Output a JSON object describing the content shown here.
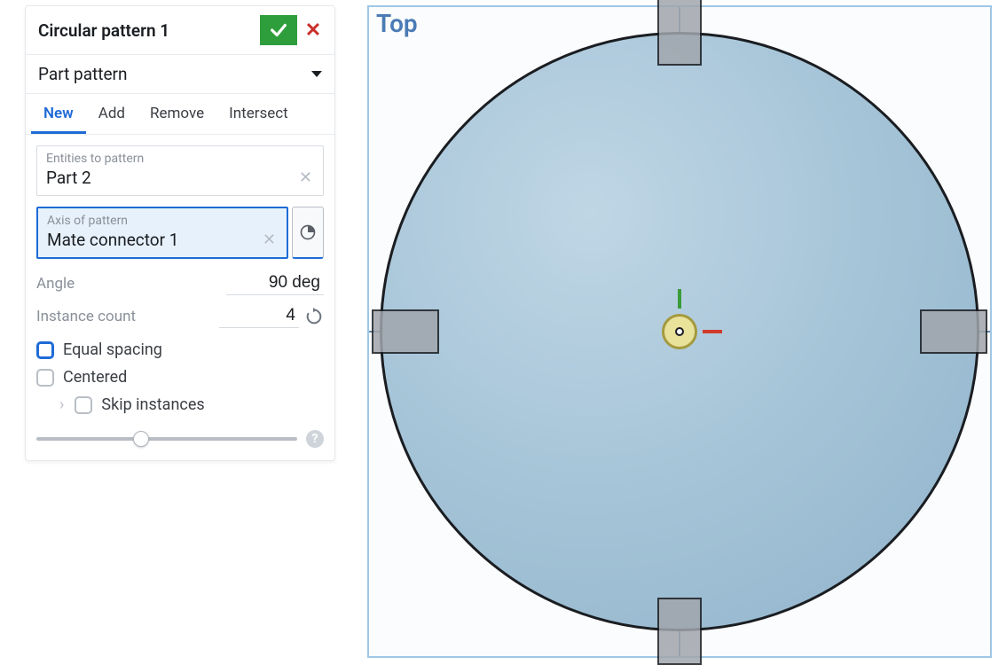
{
  "dialog": {
    "title": "Circular pattern 1",
    "pattern_type": "Part pattern",
    "tabs": [
      "New",
      "Add",
      "Remove",
      "Intersect"
    ],
    "active_tab": 0,
    "entities": {
      "caption": "Entities to pattern",
      "value": "Part 2"
    },
    "axis": {
      "caption": "Axis of pattern",
      "value": "Mate connector 1"
    },
    "angle": {
      "label": "Angle",
      "value": "90 deg"
    },
    "instance_count": {
      "label": "Instance count",
      "value": "4"
    },
    "equal_spacing_label": "Equal spacing",
    "centered_label": "Centered",
    "skip_instances_label": "Skip instances"
  },
  "viewport": {
    "label": "Top"
  }
}
